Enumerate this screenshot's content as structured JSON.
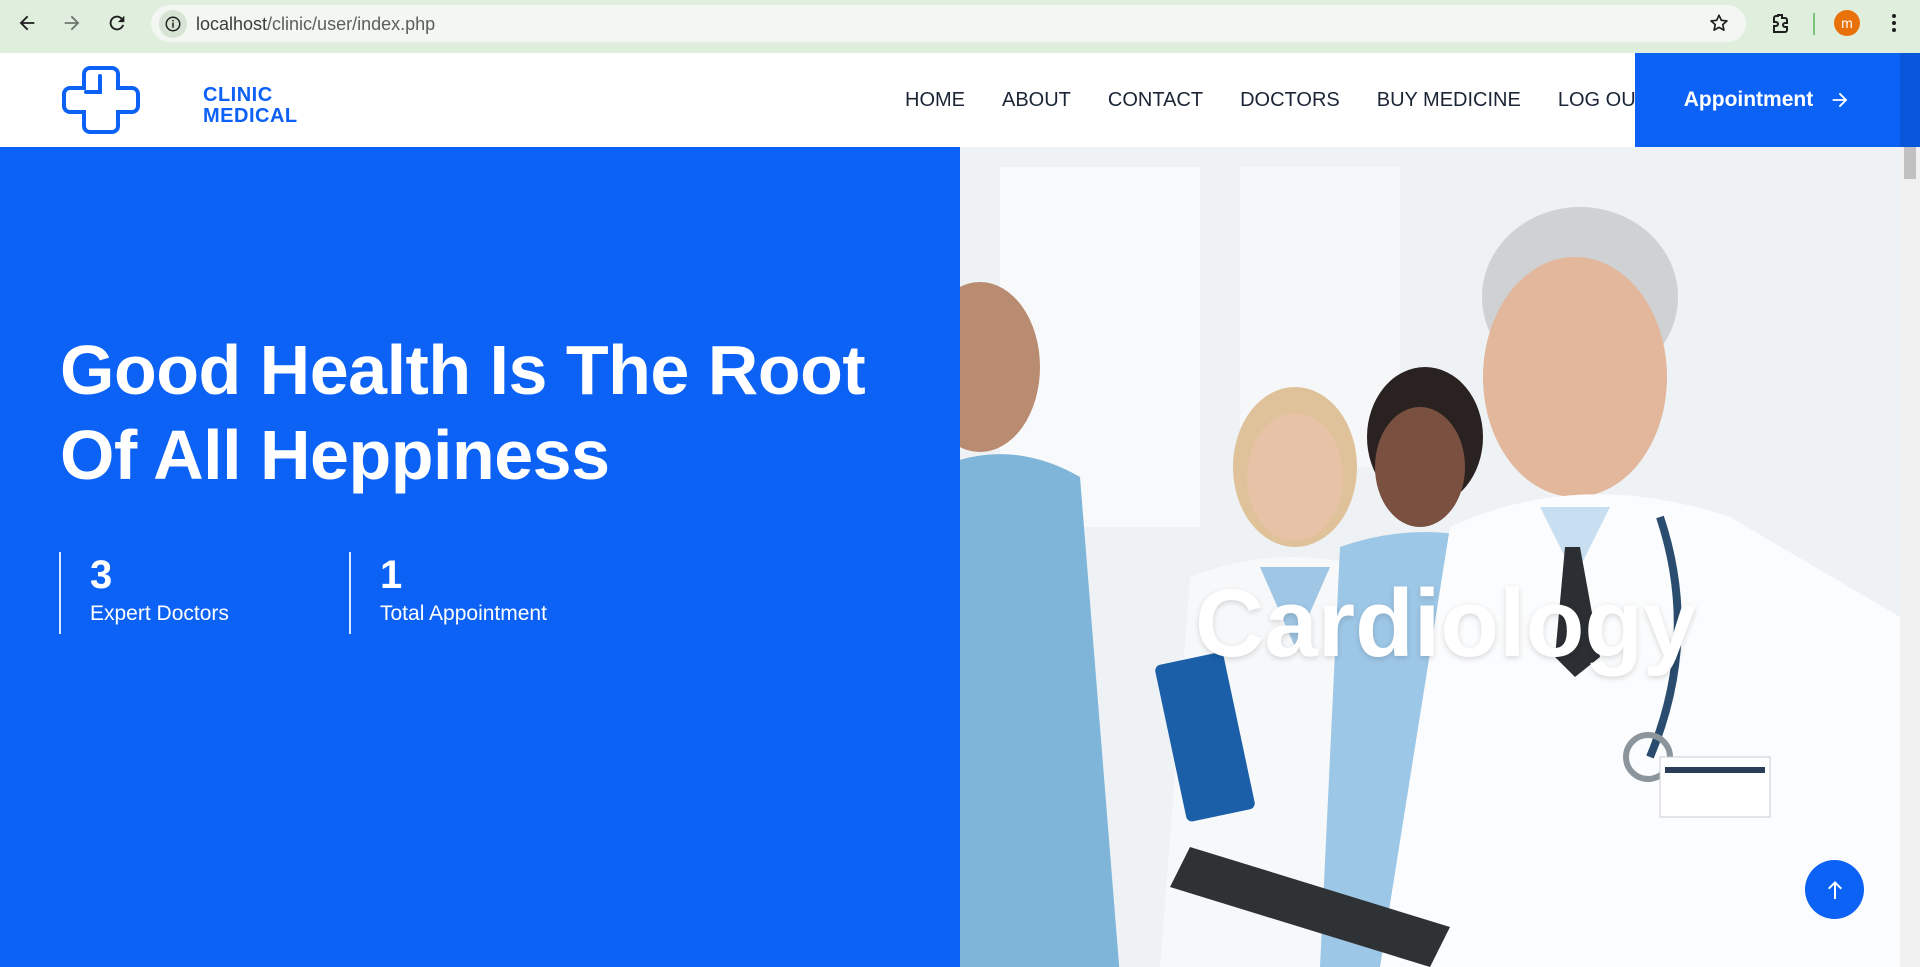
{
  "browser": {
    "url_host": "localhost",
    "url_path": "/clinic/user/index.php",
    "profile_initial": "m",
    "icons": [
      "back-icon",
      "forward-icon",
      "reload-icon",
      "site-info-icon",
      "bookmark-star-icon",
      "extensions-icon",
      "kebab-menu-icon"
    ]
  },
  "header": {
    "logo_line1": "CLINIC",
    "logo_line2": "MEDICAL",
    "nav": {
      "home": "HOME",
      "about": "ABOUT",
      "contact": "CONTACT",
      "doctors": "DOCTORS",
      "buy_medicine": "BUY MEDICINE",
      "logout": "LOG OUT"
    },
    "appointment_label": "Appointment"
  },
  "hero": {
    "title_line1": "Good Health Is The Root",
    "title_line2": "Of All Heppiness",
    "stats": [
      {
        "value": "3",
        "label": "Expert Doctors"
      },
      {
        "value": "1",
        "label": "Total Appointment"
      }
    ],
    "slide_caption": "Cardiology"
  },
  "colors": {
    "brand_blue": "#0c62f5",
    "chrome_green": "#dfeedd",
    "nav_text": "#1b2536"
  }
}
